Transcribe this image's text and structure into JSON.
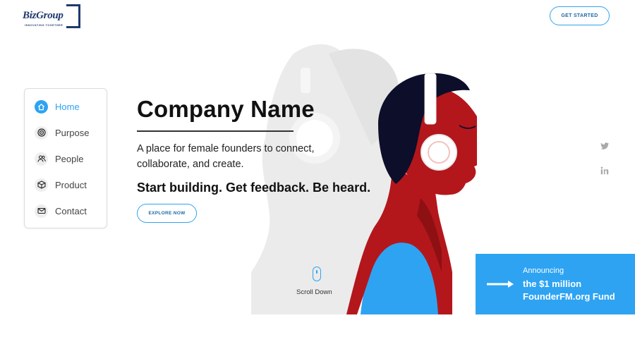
{
  "logo": {
    "name_part1": "Biz",
    "name_part2": "Group",
    "tagline": "INNOVATING TOGETHER"
  },
  "header": {
    "cta_label": "GET STARTED"
  },
  "sidenav": {
    "items": [
      {
        "label": "Home",
        "icon": "home-icon",
        "active": true
      },
      {
        "label": "Purpose",
        "icon": "target-icon",
        "active": false
      },
      {
        "label": "People",
        "icon": "people-icon",
        "active": false
      },
      {
        "label": "Product",
        "icon": "box-icon",
        "active": false
      },
      {
        "label": "Contact",
        "icon": "mail-icon",
        "active": false
      }
    ]
  },
  "hero": {
    "title": "Company Name",
    "description": "A place for female founders to connect, collaborate, and create.",
    "tagline": "Start building. Get feedback. Be heard.",
    "cta_label": "EXPLORE NOW"
  },
  "scroll": {
    "label": "Scroll Down"
  },
  "social": {
    "icons": [
      "twitter-icon",
      "linkedin-icon"
    ]
  },
  "announcement": {
    "kicker": "Announcing",
    "line1": "the $1 million",
    "line2": "FounderFM.org Fund"
  },
  "colors": {
    "accent": "#2ea3f2",
    "brand": "#1e3a6e",
    "figure_red": "#b3171c",
    "figure_hair": "#0d0e2a",
    "figure_blue": "#2ea3f2",
    "ghost_gray": "#eaeaea"
  }
}
